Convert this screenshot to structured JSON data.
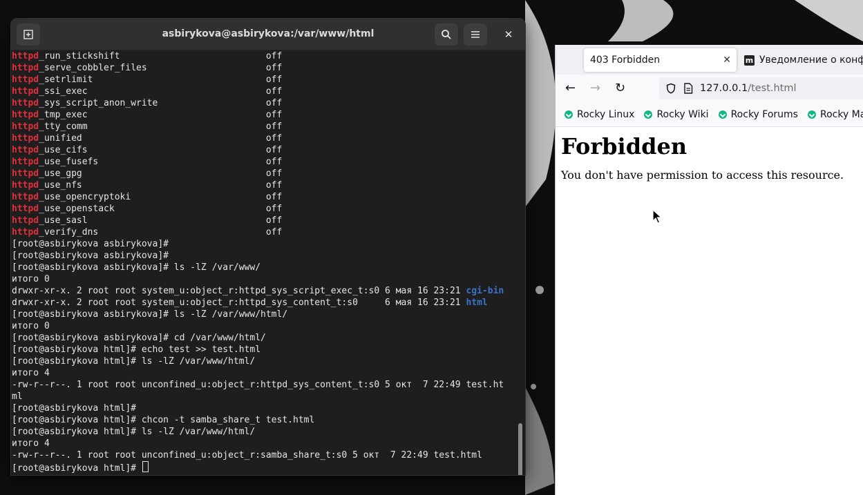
{
  "terminal": {
    "title": "asbirykova@asbirykova:/var/www/html",
    "lines": [
      {
        "hl": "httpd",
        "rest": "_run_stickshift                           off"
      },
      {
        "hl": "httpd",
        "rest": "_serve_cobbler_files                      off"
      },
      {
        "hl": "httpd",
        "rest": "_setrlimit                                off"
      },
      {
        "hl": "httpd",
        "rest": "_ssi_exec                                 off"
      },
      {
        "hl": "httpd",
        "rest": "_sys_script_anon_write                    off"
      },
      {
        "hl": "httpd",
        "rest": "_tmp_exec                                 off"
      },
      {
        "hl": "httpd",
        "rest": "_tty_comm                                 off"
      },
      {
        "hl": "httpd",
        "rest": "_unified                                  off"
      },
      {
        "hl": "httpd",
        "rest": "_use_cifs                                 off"
      },
      {
        "hl": "httpd",
        "rest": "_use_fusefs                               off"
      },
      {
        "hl": "httpd",
        "rest": "_use_gpg                                  off"
      },
      {
        "hl": "httpd",
        "rest": "_use_nfs                                  off"
      },
      {
        "hl": "httpd",
        "rest": "_use_opencryptoki                         off"
      },
      {
        "hl": "httpd",
        "rest": "_use_openstack                            off"
      },
      {
        "hl": "httpd",
        "rest": "_use_sasl                                 off"
      },
      {
        "hl": "httpd",
        "rest": "_verify_dns                               off"
      },
      {
        "text": "[root@asbirykova asbirykova]#"
      },
      {
        "text": "[root@asbirykova asbirykova]#"
      },
      {
        "text": "[root@asbirykova asbirykova]# ls -lZ /var/www/"
      },
      {
        "text": "итого 0"
      },
      {
        "text": "drwxr-xr-x. 2 root root system_u:object_r:httpd_sys_script_exec_t:s0 6 мая 16 23:21 ",
        "dir": "cgi-bin"
      },
      {
        "text": "drwxr-xr-x. 2 root root system_u:object_r:httpd_sys_content_t:s0     6 мая 16 23:21 ",
        "dir": "html"
      },
      {
        "text": "[root@asbirykova asbirykova]# ls -lZ /var/www/html/"
      },
      {
        "text": "итого 0"
      },
      {
        "text": "[root@asbirykova asbirykova]# cd /var/www/html/"
      },
      {
        "text": "[root@asbirykova html]# echo test >> test.html"
      },
      {
        "text": "[root@asbirykova html]# ls -lZ /var/www/html/"
      },
      {
        "text": "итого 4"
      },
      {
        "text": "-rw-r--r--. 1 root root unconfined_u:object_r:httpd_sys_content_t:s0 5 окт  7 22:49 test.ht"
      },
      {
        "text": "ml"
      },
      {
        "text": "[root@asbirykova html]#"
      },
      {
        "text": "[root@asbirykova html]# chcon -t samba_share_t test.html"
      },
      {
        "text": "[root@asbirykova html]# ls -lZ /var/www/html/"
      },
      {
        "text": "итого 4"
      },
      {
        "text": "-rw-r--r--. 1 root root unconfined_u:object_r:samba_share_t:s0 5 окт  7 22:49 test.html"
      },
      {
        "text": "[root@asbirykova html]# ",
        "cursor": true
      }
    ]
  },
  "browser": {
    "active_tab": "403 Forbidden",
    "inactive_tab": "Уведомление о конфи",
    "url_host": "127.0.0.1",
    "url_path": "/test.html",
    "bookmarks": [
      "Rocky Linux",
      "Rocky Wiki",
      "Rocky Forums",
      "Rocky Matte"
    ],
    "heading": "Forbidden",
    "message": "You don't have permission to access this resource."
  }
}
